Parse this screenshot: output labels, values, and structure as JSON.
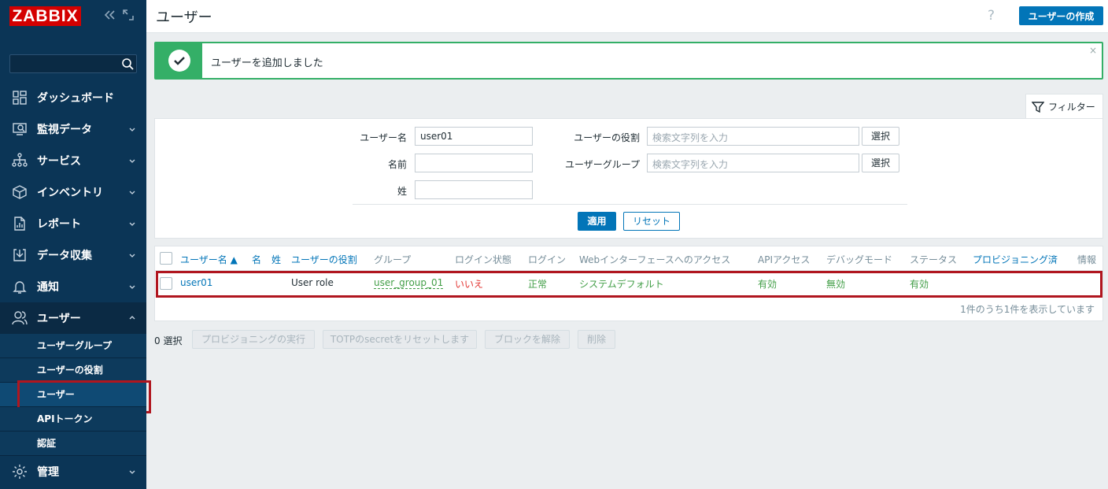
{
  "app": {
    "logo": "ZABBIX"
  },
  "sidebar": {
    "items": [
      {
        "label": "ダッシュボード",
        "icon": "dashboard-icon"
      },
      {
        "label": "監視データ",
        "icon": "monitoring-icon"
      },
      {
        "label": "サービス",
        "icon": "services-icon"
      },
      {
        "label": "インベントリ",
        "icon": "inventory-icon"
      },
      {
        "label": "レポート",
        "icon": "reports-icon"
      },
      {
        "label": "データ収集",
        "icon": "data-collection-icon"
      },
      {
        "label": "通知",
        "icon": "bell-icon"
      },
      {
        "label": "ユーザー",
        "icon": "users-icon"
      }
    ],
    "submenu": [
      "ユーザーグループ",
      "ユーザーの役割",
      "ユーザー",
      "APIトークン",
      "認証"
    ],
    "admin": {
      "label": "管理",
      "icon": "gear-icon"
    }
  },
  "header": {
    "title": "ユーザー",
    "help": "?",
    "create_label": "ユーザーの作成"
  },
  "message": {
    "text": "ユーザーを追加しました",
    "close": "×"
  },
  "filter": {
    "tab_label": "フィルター",
    "username_label": "ユーザー名",
    "username_value": "user01",
    "name_label": "名前",
    "name_value": "",
    "surname_label": "姓",
    "surname_value": "",
    "role_label": "ユーザーの役割",
    "role_placeholder": "検索文字列を入力",
    "group_label": "ユーザーグループ",
    "group_placeholder": "検索文字列を入力",
    "select_label": "選択",
    "apply_label": "適用",
    "reset_label": "リセット"
  },
  "table": {
    "headers": {
      "username": "ユーザー名 ▲",
      "name": "名",
      "surname": "姓",
      "role": "ユーザーの役割",
      "groups": "グループ",
      "is_online": "ログイン状態",
      "login": "ログイン",
      "frontend": "Webインターフェースへのアクセス",
      "api": "APIアクセス",
      "debug": "デバッグモード",
      "status": "ステータス",
      "provisioned": "プロビジョニング済",
      "info": "情報"
    },
    "rows": [
      {
        "username": "user01",
        "name": "",
        "surname": "",
        "role": "User role",
        "groups": "user_group_01",
        "is_online": "いいえ",
        "login": "正常",
        "frontend": "システムデフォルト",
        "api": "有効",
        "debug": "無効",
        "status": "有効"
      }
    ],
    "footer": "1件のうち1件を表示しています"
  },
  "actions": {
    "selected": "0 選択",
    "provision": "プロビジョニングの実行",
    "reset_totp": "TOTPのsecretをリセットします",
    "unblock": "ブロックを解除",
    "delete": "削除"
  },
  "colors": {
    "sidebar": "#0b3556",
    "accent": "#0275b8",
    "success": "#34af67",
    "danger": "#e33734",
    "highlight": "#b0161f"
  }
}
